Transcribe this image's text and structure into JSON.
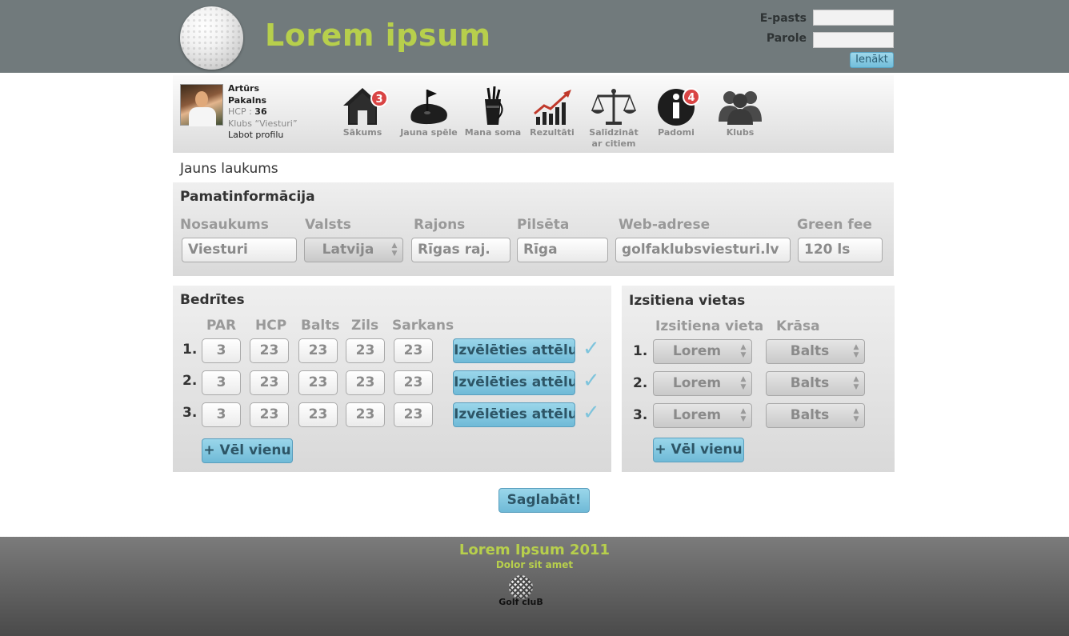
{
  "header": {
    "site_title": "Lorem ipsum",
    "email_label": "E-pasts",
    "password_label": "Parole",
    "login_button": "Ienākt"
  },
  "profile": {
    "first_name": "Artūrs",
    "last_name": "Pakalns",
    "hcp_label": "HCP :",
    "hcp_value": "36",
    "club": "Klubs “Viesturi”",
    "edit_link": "Labot profilu"
  },
  "nav": {
    "items": [
      {
        "label": "Sākums",
        "icon": "home-icon",
        "badge": "3"
      },
      {
        "label": "Jauna spēle",
        "icon": "golf-green-icon"
      },
      {
        "label": "Mana soma",
        "icon": "golf-bag-icon"
      },
      {
        "label": "Rezultāti",
        "icon": "chart-icon"
      },
      {
        "label": "Salīdzināt",
        "label2": "ar citiem",
        "icon": "scales-icon"
      },
      {
        "label": "Padomi",
        "icon": "info-icon",
        "badge": "4"
      },
      {
        "label": "Klubs",
        "icon": "group-icon"
      }
    ]
  },
  "page_heading": "Jauns laukums",
  "basic_info": {
    "title": "Pamatinformācija",
    "columns": [
      "Nosaukums",
      "Valsts",
      "Rajons",
      "Pilsēta",
      "Web-adrese",
      "Green fee"
    ],
    "values": {
      "name": "Viesturi",
      "country": "Latvija",
      "district": "Rīgas raj.",
      "city": "Rīga",
      "web": "golfaklubsviesturi.lv",
      "green_fee": "120 ls"
    }
  },
  "holes": {
    "title": "Bedrītes",
    "columns": [
      "PAR",
      "HCP",
      "Balts",
      "Zils",
      "Sarkans"
    ],
    "rows": [
      {
        "num": "1.",
        "par": "3",
        "hcp": "23",
        "white": "23",
        "blue": "23",
        "red": "23"
      },
      {
        "num": "2.",
        "par": "3",
        "hcp": "23",
        "white": "23",
        "blue": "23",
        "red": "23"
      },
      {
        "num": "3.",
        "par": "3",
        "hcp": "23",
        "white": "23",
        "blue": "23",
        "red": "23"
      }
    ],
    "choose_image": "Izvēlēties attēlu",
    "check": "✓",
    "add_more": "+ Vēl vienu"
  },
  "tees": {
    "title": "Izsitiena vietas",
    "columns": [
      "Izsitiena vieta",
      "Krāsa"
    ],
    "rows": [
      {
        "num": "1.",
        "place": "Lorem",
        "color": "Balts"
      },
      {
        "num": "2.",
        "place": "Lorem",
        "color": "Balts"
      },
      {
        "num": "3.",
        "place": "Lorem",
        "color": "Balts"
      }
    ],
    "add_more": "+ Vēl vienu"
  },
  "save_button": "Saglabāt!",
  "footer": {
    "title": "Lorem Ipsum 2011",
    "subtitle": "Dolor sit amet",
    "logo_text": "Golf cluB"
  },
  "colors": {
    "header_bg": "#717a7c",
    "accent_green": "#b7cf4c",
    "button_blue": "#7ec4dc",
    "badge_red": "#d94444"
  }
}
